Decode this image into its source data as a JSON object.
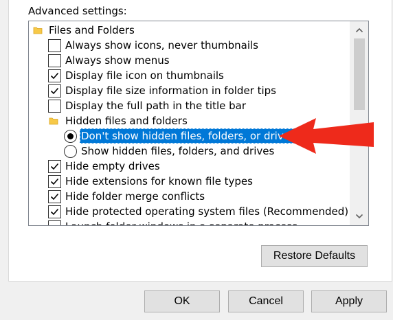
{
  "advanced_settings": {
    "label": "Advanced settings:",
    "items": [
      {
        "type": "folder",
        "label": "Files and Folders",
        "icon": "folder-icon"
      },
      {
        "type": "checkbox",
        "label": "Always show icons, never thumbnails",
        "checked": false
      },
      {
        "type": "checkbox",
        "label": "Always show menus",
        "checked": false
      },
      {
        "type": "checkbox",
        "label": "Display file icon on thumbnails",
        "checked": true
      },
      {
        "type": "checkbox",
        "label": "Display file size information in folder tips",
        "checked": true
      },
      {
        "type": "checkbox",
        "label": "Display the full path in the title bar",
        "checked": false
      },
      {
        "type": "folder",
        "label": "Hidden files and folders",
        "icon": "folder-icon"
      },
      {
        "type": "radio",
        "label": "Don't show hidden files, folders, or drives",
        "selected": true,
        "highlighted": true
      },
      {
        "type": "radio",
        "label": "Show hidden files, folders, and drives",
        "selected": false
      },
      {
        "type": "checkbox",
        "label": "Hide empty drives",
        "checked": true
      },
      {
        "type": "checkbox",
        "label": "Hide extensions for known file types",
        "checked": true
      },
      {
        "type": "checkbox",
        "label": "Hide folder merge conflicts",
        "checked": true
      },
      {
        "type": "checkbox",
        "label": "Hide protected operating system files (Recommended)",
        "checked": true
      },
      {
        "type": "checkbox",
        "label": "Launch folder windows in a separate process",
        "checked": false
      }
    ]
  },
  "buttons": {
    "restore_defaults": "Restore Defaults",
    "ok": "OK",
    "cancel": "Cancel",
    "apply": "Apply"
  },
  "annotation": {
    "arrow_color": "#ee2a1b",
    "icon": "red-arrow-icon"
  },
  "colors": {
    "selection": "#0078d7",
    "folder": "#f7c948"
  }
}
